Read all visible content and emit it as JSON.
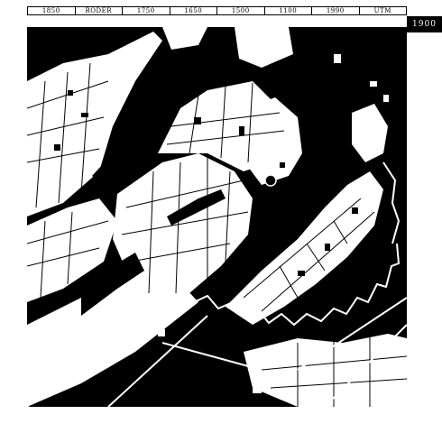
{
  "scale_bar": {
    "labels": [
      "1850",
      "RODER",
      "1750",
      "1650",
      "1500",
      "1100",
      "1990",
      "UTM"
    ]
  },
  "year_badge": "1900",
  "map": {
    "land_color": "#000000",
    "street_color": "#ffffff",
    "paper_color": "#ffffff"
  }
}
